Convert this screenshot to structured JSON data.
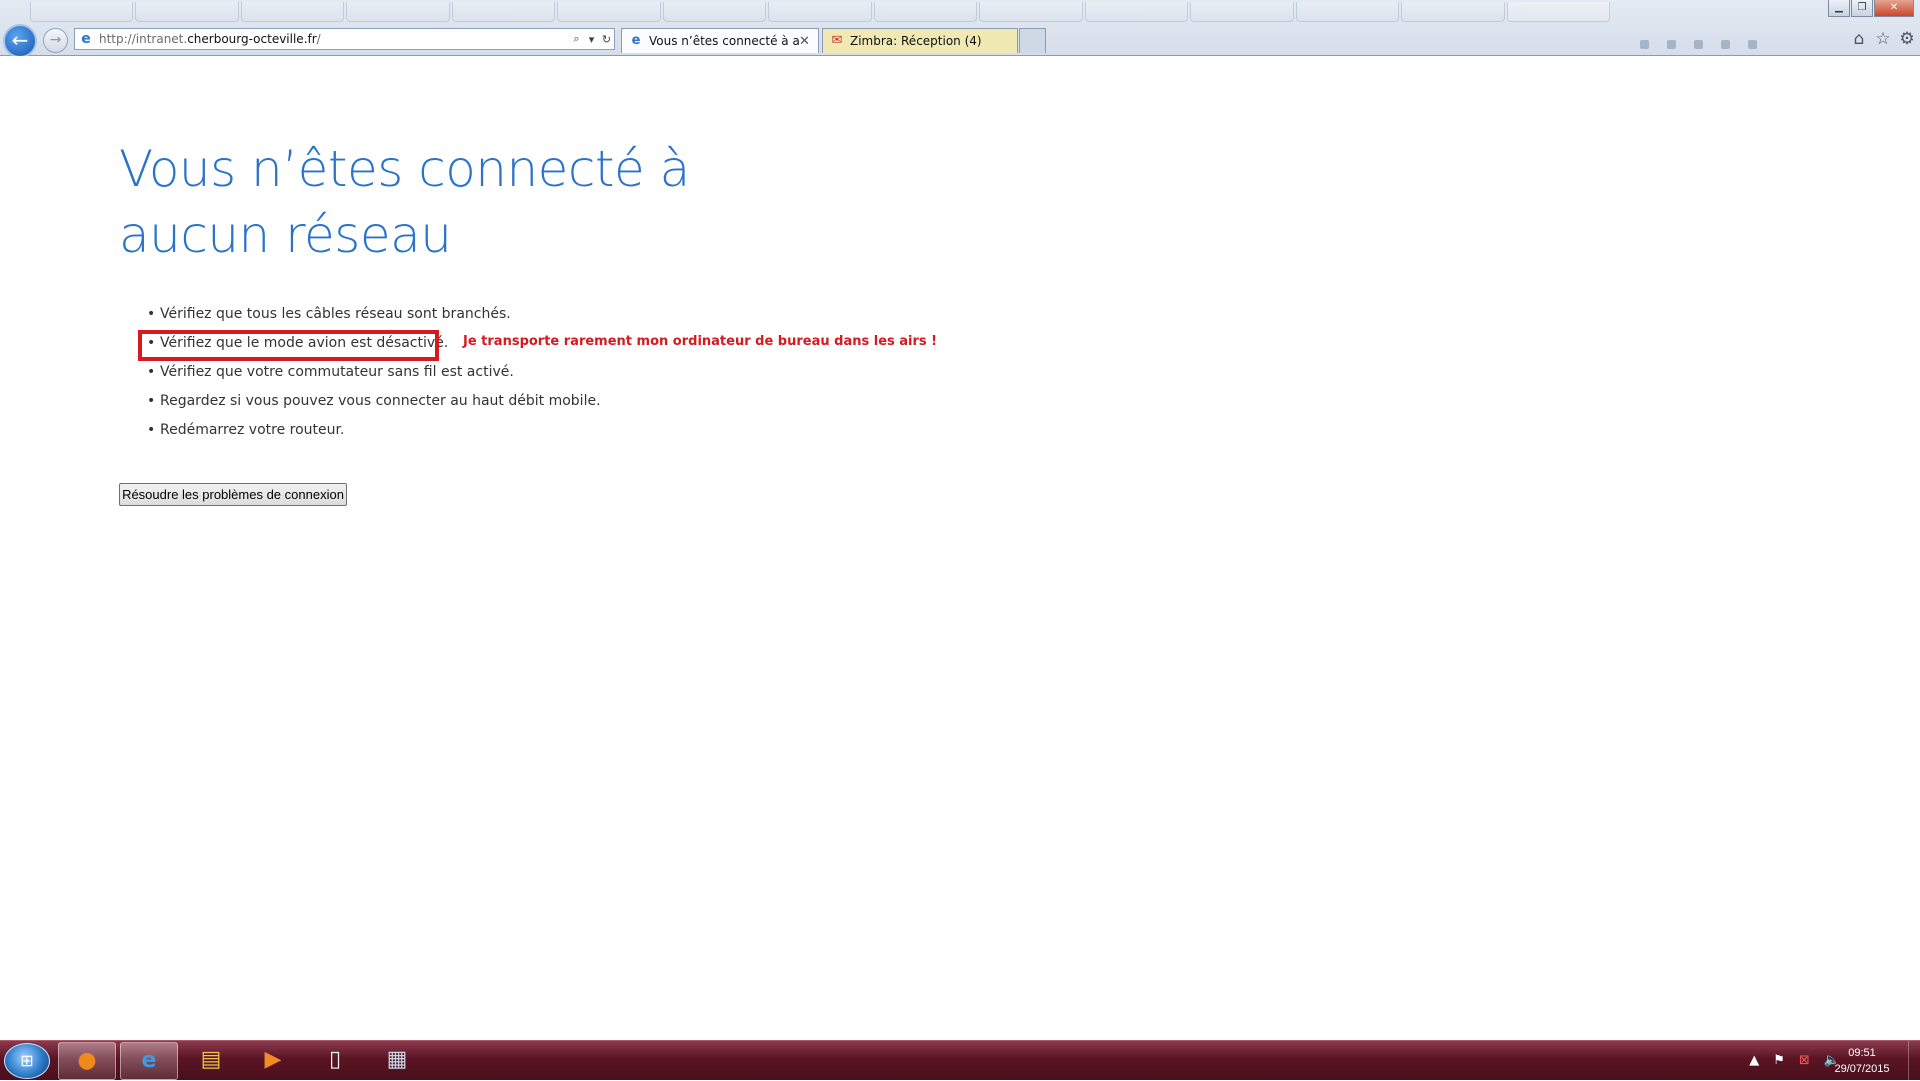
{
  "browser": {
    "address_url_prefix": "http://intranet.",
    "address_url_domain": "cherbourg-octeville.fr",
    "address_url_suffix": "/",
    "tabs": [
      {
        "label": "Vous n’êtes connecté à auc...",
        "icon": "ie-icon",
        "active": true
      },
      {
        "label": "Zimbra: Réception (4)",
        "icon": "zimbra-icon",
        "active": false
      }
    ]
  },
  "page": {
    "title": "Vous n’êtes connecté à aucun réseau",
    "checks": [
      "Vérifiez que tous les câbles réseau sont branchés.",
      "Vérifiez que le mode avion est désactivé.",
      "Vérifiez que votre commutateur sans fil est activé.",
      "Regardez si vous pouvez vous connecter au haut débit mobile.",
      "Redémarrez votre routeur."
    ],
    "annotation": "Je transporte rarement mon ordinateur de bureau dans les airs !",
    "fix_button": "Résoudre les problèmes de connexion",
    "highlight_color": "#d71920"
  },
  "taskbar": {
    "clock_time": "09:51",
    "clock_date": "29/07/2015",
    "apps": [
      "firefox-icon",
      "internet-explorer-icon",
      "file-explorer-icon",
      "media-player-icon",
      "notepad-icon",
      "calculator-icon"
    ]
  },
  "colors": {
    "title_blue": "#2a73c9",
    "taskbar": "#5a1424"
  }
}
